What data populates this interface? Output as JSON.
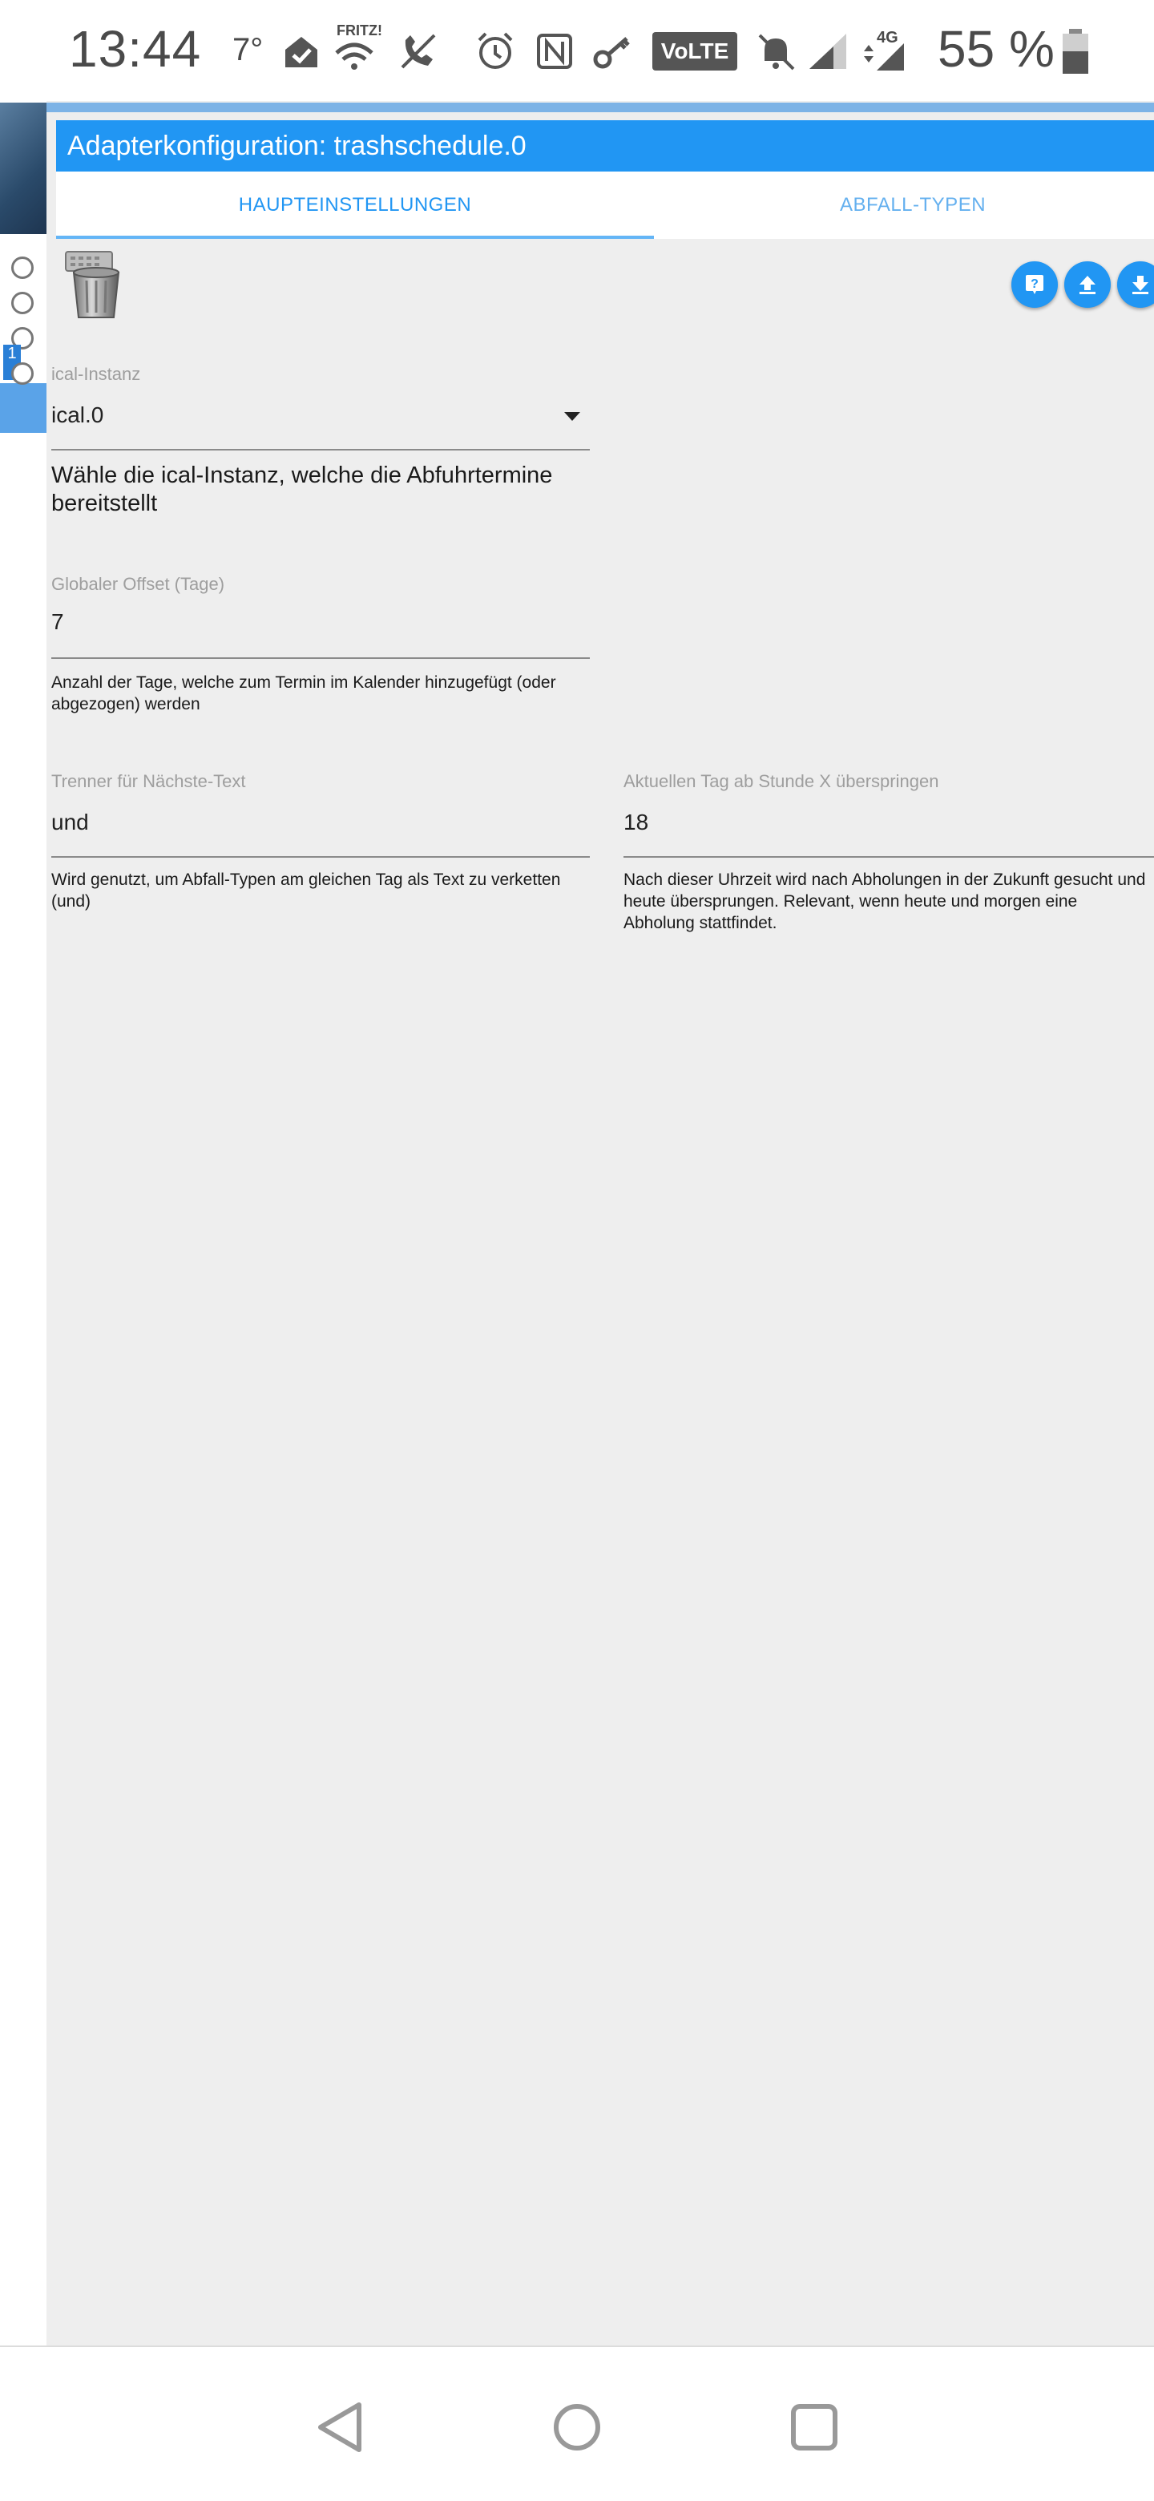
{
  "status_bar": {
    "time": "13:44",
    "temperature": "7°",
    "fritz_label": "FRITZ!",
    "volte": "VoLTE",
    "network": "4G",
    "battery": "55 %",
    "icons": [
      "home-check-icon",
      "wifi-icon",
      "call-muted-icon",
      "alarm-icon",
      "nfc-icon",
      "key-icon",
      "volte-icon",
      "bell-off-icon",
      "signal-icon",
      "signal-4g-icon",
      "battery-icon"
    ]
  },
  "window": {
    "title": "Adapterkonfiguration: trashschedule.0"
  },
  "tabs": [
    {
      "label": "HAUPTEINSTELLUNGEN",
      "active": true
    },
    {
      "label": "ABFALL-TYPEN",
      "active": false
    }
  ],
  "toolbar": {
    "help_icon": "help-icon",
    "upload_icon": "upload-icon",
    "download_icon": "download-icon"
  },
  "form": {
    "ical_instance": {
      "label": "ical-Instanz",
      "value": "ical.0",
      "helper": "Wähle die ical-Instanz, welche die Abfuhrtermine bereitstellt"
    },
    "global_offset": {
      "label": "Globaler Offset (Tage)",
      "value": "7",
      "helper": "Anzahl der Tage, welche zum Termin im Kalender hinzugefügt (oder abgezogen) werden"
    },
    "separator": {
      "label": "Trenner für Nächste-Text",
      "value": "und",
      "helper": "Wird genutzt, um Abfall-Typen am gleichen Tag als Text zu verketten (und)"
    },
    "skip_hour": {
      "label": "Aktuellen Tag ab Stunde X überspringen",
      "value": "18",
      "helper": "Nach dieser Uhrzeit wird nach Abholungen in der Zukunft gesucht und heute übersprungen. Relevant, wenn heute und morgen eine Abholung stattfindet."
    }
  },
  "side": {
    "tab_label": "1"
  },
  "colors": {
    "accent": "#2196f3",
    "panel_bg": "#eeeeee"
  }
}
